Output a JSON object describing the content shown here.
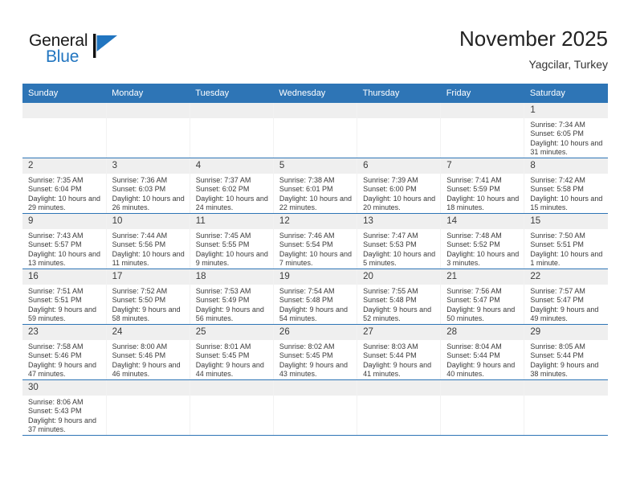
{
  "brand": {
    "name_top": "General",
    "name_bottom": "Blue",
    "accent_color": "#2175c0",
    "flag_icon": "blue-flag-triangle"
  },
  "header": {
    "title": "November 2025",
    "subtitle": "Yagcilar, Turkey"
  },
  "theme": {
    "header_bar_color": "#2e75b6",
    "day_number_bg": "#efefef",
    "row_divider_color": "#2e75b6",
    "text_color": "#3a3a3a"
  },
  "calendar": {
    "weekday_headers": [
      "Sunday",
      "Monday",
      "Tuesday",
      "Wednesday",
      "Thursday",
      "Friday",
      "Saturday"
    ],
    "labels": {
      "sunrise": "Sunrise:",
      "sunset": "Sunset:",
      "daylight": "Daylight:"
    },
    "weeks": [
      [
        {
          "day": "",
          "blank": true
        },
        {
          "day": "",
          "blank": true
        },
        {
          "day": "",
          "blank": true
        },
        {
          "day": "",
          "blank": true
        },
        {
          "day": "",
          "blank": true
        },
        {
          "day": "",
          "blank": true
        },
        {
          "day": "1",
          "sunrise": "Sunrise: 7:34 AM",
          "sunset": "Sunset: 6:05 PM",
          "daylight": "Daylight: 10 hours and 31 minutes."
        }
      ],
      [
        {
          "day": "2",
          "sunrise": "Sunrise: 7:35 AM",
          "sunset": "Sunset: 6:04 PM",
          "daylight": "Daylight: 10 hours and 29 minutes."
        },
        {
          "day": "3",
          "sunrise": "Sunrise: 7:36 AM",
          "sunset": "Sunset: 6:03 PM",
          "daylight": "Daylight: 10 hours and 26 minutes."
        },
        {
          "day": "4",
          "sunrise": "Sunrise: 7:37 AM",
          "sunset": "Sunset: 6:02 PM",
          "daylight": "Daylight: 10 hours and 24 minutes."
        },
        {
          "day": "5",
          "sunrise": "Sunrise: 7:38 AM",
          "sunset": "Sunset: 6:01 PM",
          "daylight": "Daylight: 10 hours and 22 minutes."
        },
        {
          "day": "6",
          "sunrise": "Sunrise: 7:39 AM",
          "sunset": "Sunset: 6:00 PM",
          "daylight": "Daylight: 10 hours and 20 minutes."
        },
        {
          "day": "7",
          "sunrise": "Sunrise: 7:41 AM",
          "sunset": "Sunset: 5:59 PM",
          "daylight": "Daylight: 10 hours and 18 minutes."
        },
        {
          "day": "8",
          "sunrise": "Sunrise: 7:42 AM",
          "sunset": "Sunset: 5:58 PM",
          "daylight": "Daylight: 10 hours and 15 minutes."
        }
      ],
      [
        {
          "day": "9",
          "sunrise": "Sunrise: 7:43 AM",
          "sunset": "Sunset: 5:57 PM",
          "daylight": "Daylight: 10 hours and 13 minutes."
        },
        {
          "day": "10",
          "sunrise": "Sunrise: 7:44 AM",
          "sunset": "Sunset: 5:56 PM",
          "daylight": "Daylight: 10 hours and 11 minutes."
        },
        {
          "day": "11",
          "sunrise": "Sunrise: 7:45 AM",
          "sunset": "Sunset: 5:55 PM",
          "daylight": "Daylight: 10 hours and 9 minutes."
        },
        {
          "day": "12",
          "sunrise": "Sunrise: 7:46 AM",
          "sunset": "Sunset: 5:54 PM",
          "daylight": "Daylight: 10 hours and 7 minutes."
        },
        {
          "day": "13",
          "sunrise": "Sunrise: 7:47 AM",
          "sunset": "Sunset: 5:53 PM",
          "daylight": "Daylight: 10 hours and 5 minutes."
        },
        {
          "day": "14",
          "sunrise": "Sunrise: 7:48 AM",
          "sunset": "Sunset: 5:52 PM",
          "daylight": "Daylight: 10 hours and 3 minutes."
        },
        {
          "day": "15",
          "sunrise": "Sunrise: 7:50 AM",
          "sunset": "Sunset: 5:51 PM",
          "daylight": "Daylight: 10 hours and 1 minute."
        }
      ],
      [
        {
          "day": "16",
          "sunrise": "Sunrise: 7:51 AM",
          "sunset": "Sunset: 5:51 PM",
          "daylight": "Daylight: 9 hours and 59 minutes."
        },
        {
          "day": "17",
          "sunrise": "Sunrise: 7:52 AM",
          "sunset": "Sunset: 5:50 PM",
          "daylight": "Daylight: 9 hours and 58 minutes."
        },
        {
          "day": "18",
          "sunrise": "Sunrise: 7:53 AM",
          "sunset": "Sunset: 5:49 PM",
          "daylight": "Daylight: 9 hours and 56 minutes."
        },
        {
          "day": "19",
          "sunrise": "Sunrise: 7:54 AM",
          "sunset": "Sunset: 5:48 PM",
          "daylight": "Daylight: 9 hours and 54 minutes."
        },
        {
          "day": "20",
          "sunrise": "Sunrise: 7:55 AM",
          "sunset": "Sunset: 5:48 PM",
          "daylight": "Daylight: 9 hours and 52 minutes."
        },
        {
          "day": "21",
          "sunrise": "Sunrise: 7:56 AM",
          "sunset": "Sunset: 5:47 PM",
          "daylight": "Daylight: 9 hours and 50 minutes."
        },
        {
          "day": "22",
          "sunrise": "Sunrise: 7:57 AM",
          "sunset": "Sunset: 5:47 PM",
          "daylight": "Daylight: 9 hours and 49 minutes."
        }
      ],
      [
        {
          "day": "23",
          "sunrise": "Sunrise: 7:58 AM",
          "sunset": "Sunset: 5:46 PM",
          "daylight": "Daylight: 9 hours and 47 minutes."
        },
        {
          "day": "24",
          "sunrise": "Sunrise: 8:00 AM",
          "sunset": "Sunset: 5:46 PM",
          "daylight": "Daylight: 9 hours and 46 minutes."
        },
        {
          "day": "25",
          "sunrise": "Sunrise: 8:01 AM",
          "sunset": "Sunset: 5:45 PM",
          "daylight": "Daylight: 9 hours and 44 minutes."
        },
        {
          "day": "26",
          "sunrise": "Sunrise: 8:02 AM",
          "sunset": "Sunset: 5:45 PM",
          "daylight": "Daylight: 9 hours and 43 minutes."
        },
        {
          "day": "27",
          "sunrise": "Sunrise: 8:03 AM",
          "sunset": "Sunset: 5:44 PM",
          "daylight": "Daylight: 9 hours and 41 minutes."
        },
        {
          "day": "28",
          "sunrise": "Sunrise: 8:04 AM",
          "sunset": "Sunset: 5:44 PM",
          "daylight": "Daylight: 9 hours and 40 minutes."
        },
        {
          "day": "29",
          "sunrise": "Sunrise: 8:05 AM",
          "sunset": "Sunset: 5:44 PM",
          "daylight": "Daylight: 9 hours and 38 minutes."
        }
      ],
      [
        {
          "day": "30",
          "sunrise": "Sunrise: 8:06 AM",
          "sunset": "Sunset: 5:43 PM",
          "daylight": "Daylight: 9 hours and 37 minutes."
        },
        {
          "day": "",
          "blank": true
        },
        {
          "day": "",
          "blank": true
        },
        {
          "day": "",
          "blank": true
        },
        {
          "day": "",
          "blank": true
        },
        {
          "day": "",
          "blank": true
        },
        {
          "day": "",
          "blank": true
        }
      ]
    ]
  }
}
